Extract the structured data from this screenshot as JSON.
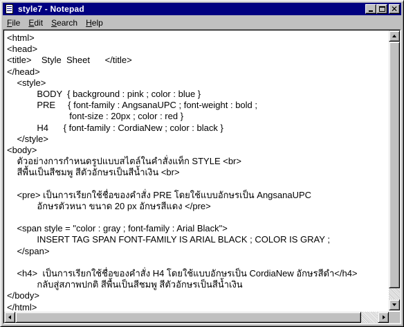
{
  "window": {
    "title": "style7 - Notepad",
    "icon": "notepad-icon"
  },
  "caption_buttons": {
    "minimize": "minimize-icon",
    "maximize": "maximize-icon",
    "close": "close-icon",
    "close_glyph": "✕"
  },
  "menu": {
    "items": [
      {
        "first": "F",
        "rest": "ile"
      },
      {
        "first": "E",
        "rest": "dit"
      },
      {
        "first": "S",
        "rest": "earch"
      },
      {
        "first": "H",
        "rest": "elp"
      }
    ]
  },
  "editor": {
    "lines": [
      "<html>",
      "<head>",
      "<title>    Style  Sheet      </title>",
      "</head>",
      "    <style>",
      "            BODY  { background : pink ; color : blue }",
      "            PRE     { font-family : AngsanaUPC ; font-weight : bold ;",
      "                         font-size : 20px ; color : red }",
      "            H4      { font-family : CordiaNew ; color : black }",
      "    </style>",
      "<body>",
      "    ตัวอย่างการกำหนดรูปแบบสไตล์ในคำสั่งแท็ก STYLE <br>",
      "    สีพื้นเป็นสีชมพู สีตัวอักษรเป็นสีน้ำเงิน <br>",
      "",
      "    <pre> เป็นการเรียกใช้ชื่อของคำสั่ง PRE โดยใช้แบบอักษรเป็น AngsanaUPC",
      "            อักษรตัวหนา ขนาด 20 px อักษรสีแดง </pre>",
      "",
      "    <span style = \"color : gray ; font-family : Arial Black\">",
      "            INSERT TAG SPAN FONT-FAMILY IS ARIAL BLACK ; COLOR IS GRAY ;",
      "    </span>",
      "",
      "    <h4>  เป็นการเรียกใช้ชื่อของคำสั่ง H4 โดยใช้แบบอักษรเป็น CordiaNew อักษรสีดำ</h4>",
      "            กลับสู่สภาพปกติ สีพื้นเป็นสีชมพู สีตัวอักษรเป็นสีน้ำเงิน",
      "</body>",
      "</html>"
    ]
  },
  "colors": {
    "titlebar": "#000080",
    "chrome": "#c0c0c0",
    "editor_bg": "#ffffff"
  }
}
